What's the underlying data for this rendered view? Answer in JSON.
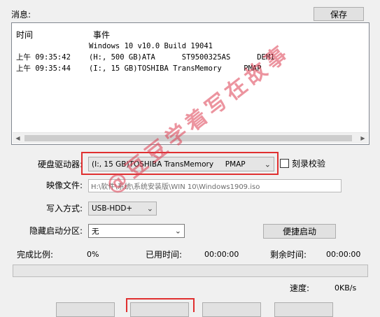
{
  "messages_label": "消息:",
  "save_button": "保存",
  "log": {
    "headers": {
      "time": "时间",
      "event": "事件"
    },
    "rows": [
      {
        "time": "",
        "event": "Windows 10 v10.0 Build 19041"
      },
      {
        "time": "上午 09:35:42",
        "event": "(H:, 500 GB)ATA      ST9500325AS      DEM1"
      },
      {
        "time": "上午 09:35:44",
        "event": "(I:, 15 GB)TOSHIBA TransMemory     PMAP"
      }
    ]
  },
  "disk": {
    "label": "硬盘驱动器:",
    "value": "(I:, 15 GB)TOSHIBA TransMemory     PMAP",
    "verify_label": "刻录校验"
  },
  "image": {
    "label": "映像文件:",
    "value": "H:\\软件\\系统\\系统安装版\\WIN 10\\Windows1909.iso"
  },
  "write_mode": {
    "label": "写入方式:",
    "value": "USB-HDD+"
  },
  "hidden_partition": {
    "label": "隐藏启动分区:",
    "value": "无"
  },
  "quick_boot_button": "便捷启动",
  "progress": {
    "done_label": "完成比例:",
    "done_value": "0%",
    "elapsed_label": "已用时间:",
    "elapsed_value": "00:00:00",
    "remaining_label": "剩余时间:",
    "remaining_value": "00:00:00",
    "fraction": 0,
    "speed_label": "速度:",
    "speed_value": "0KB/s"
  },
  "watermark": "@豆豆学着写在故事"
}
